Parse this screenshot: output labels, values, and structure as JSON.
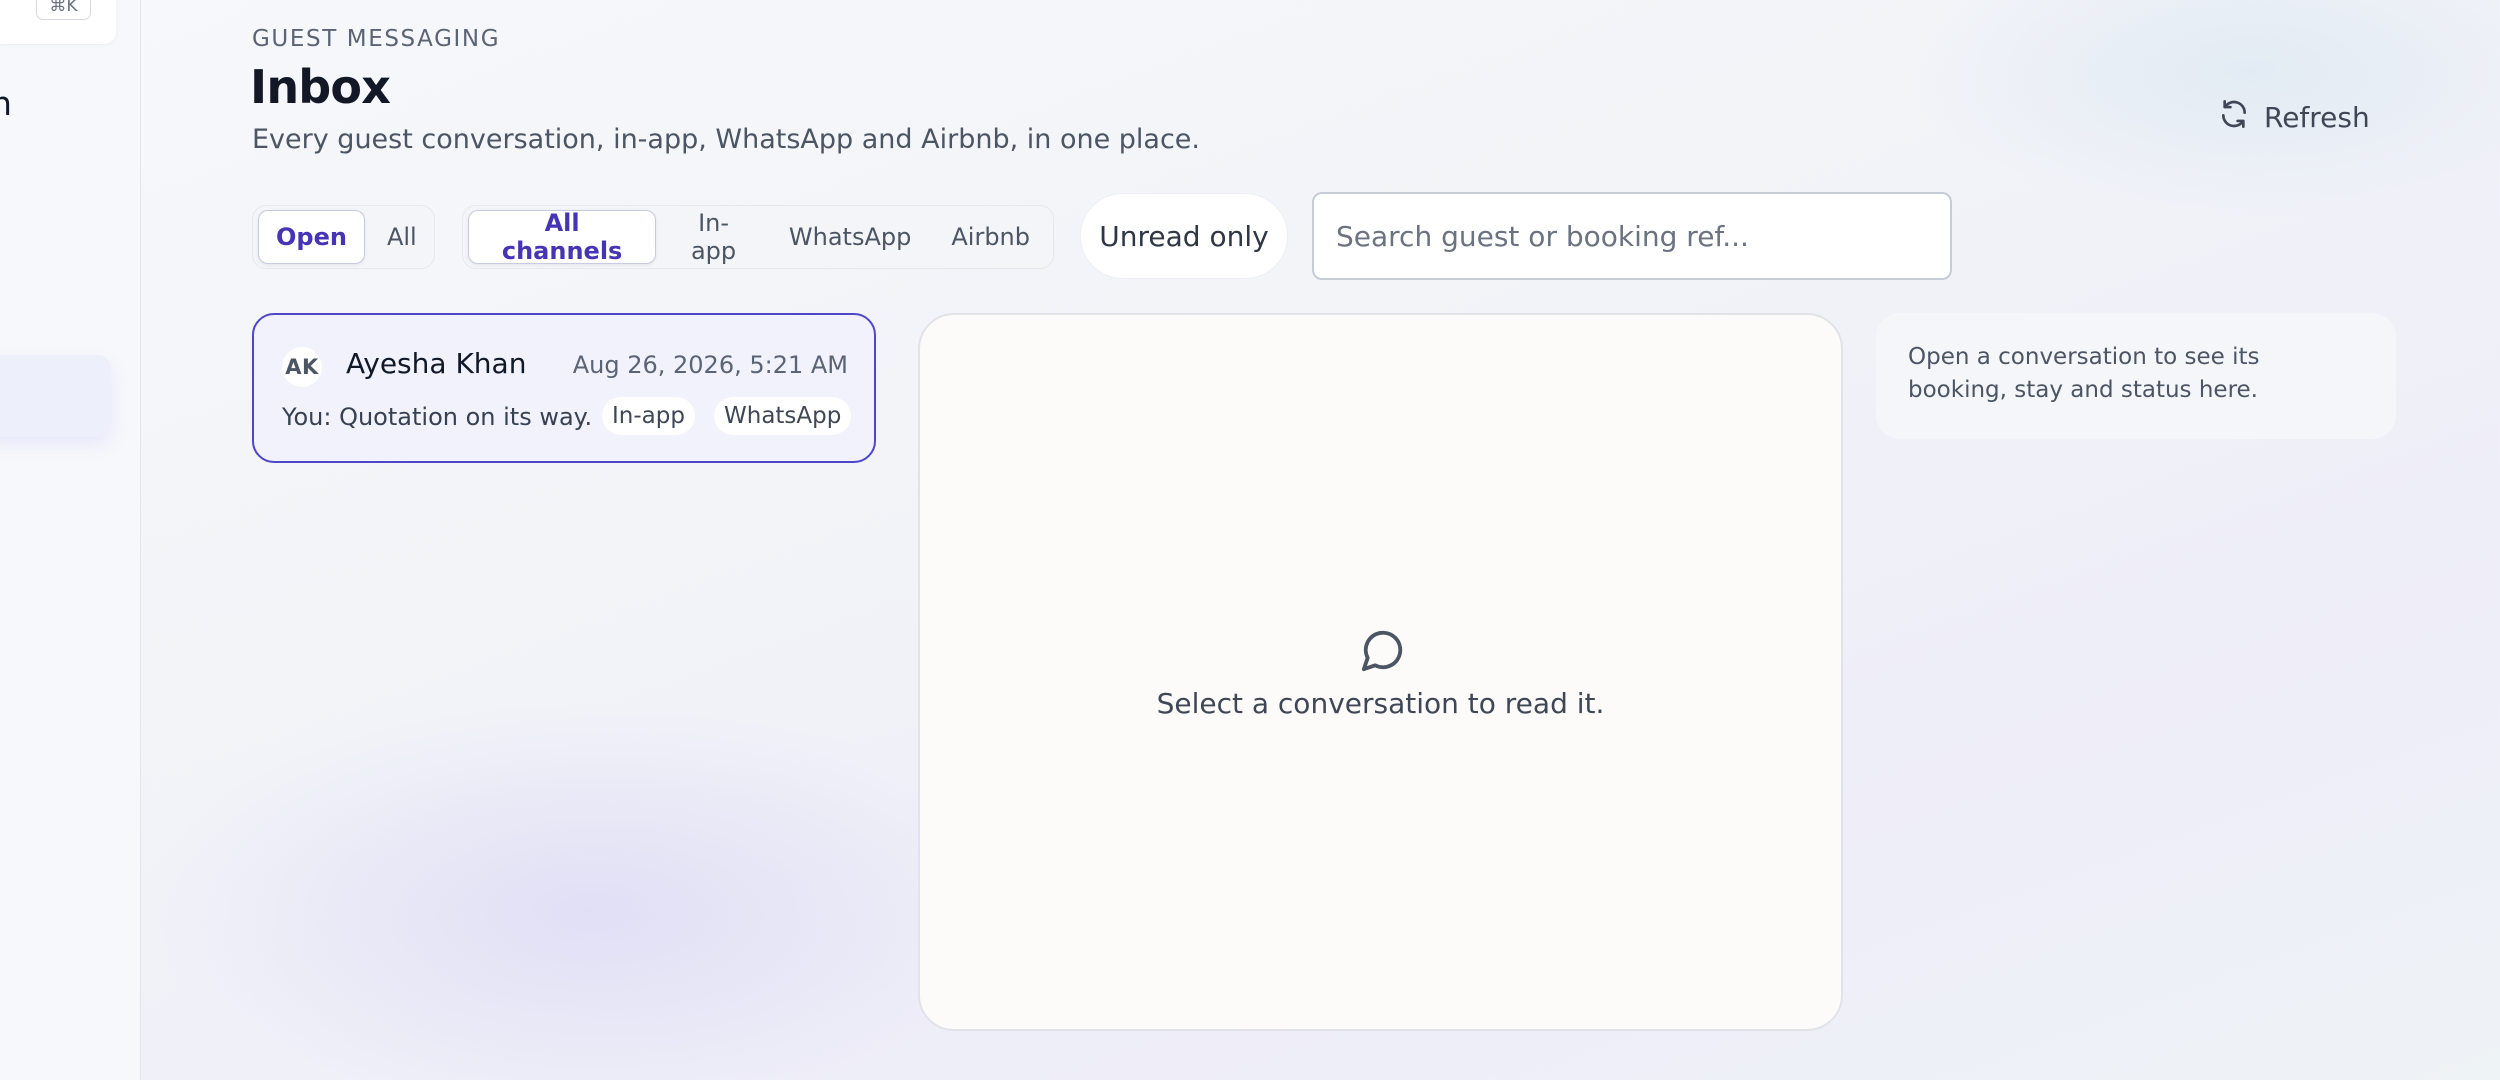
{
  "sidebar": {
    "shortcut": "⌘K",
    "partial_label": "n"
  },
  "header": {
    "eyebrow": "GUEST MESSAGING",
    "title": "Inbox",
    "subtitle": "Every guest conversation, in-app, WhatsApp and Airbnb, in one place.",
    "refresh_label": "Refresh"
  },
  "filters": {
    "status": [
      {
        "label": "Open",
        "active": true
      },
      {
        "label": "All",
        "active": false
      }
    ],
    "channels": [
      {
        "label": "All channels",
        "active": true
      },
      {
        "label": "In-app",
        "active": false
      },
      {
        "label": "WhatsApp",
        "active": false
      },
      {
        "label": "Airbnb",
        "active": false
      }
    ],
    "unread_label": "Unread only",
    "search_placeholder": "Search guest or booking ref..."
  },
  "conversations": [
    {
      "initials": "AK",
      "name": "Ayesha Khan",
      "time": "Aug 26, 2026, 5:21 AM",
      "preview": "You: Quotation on its way.",
      "tags": [
        "In-app",
        "WhatsApp"
      ],
      "selected": true
    }
  ],
  "reader": {
    "icon": "chat-bubble-icon",
    "empty_text": "Select a conversation to read it."
  },
  "details": {
    "hint": "Open a conversation to see its booking, stay and status here."
  },
  "colors": {
    "accent": "#4f46c8",
    "accent_text": "#4634b4"
  }
}
